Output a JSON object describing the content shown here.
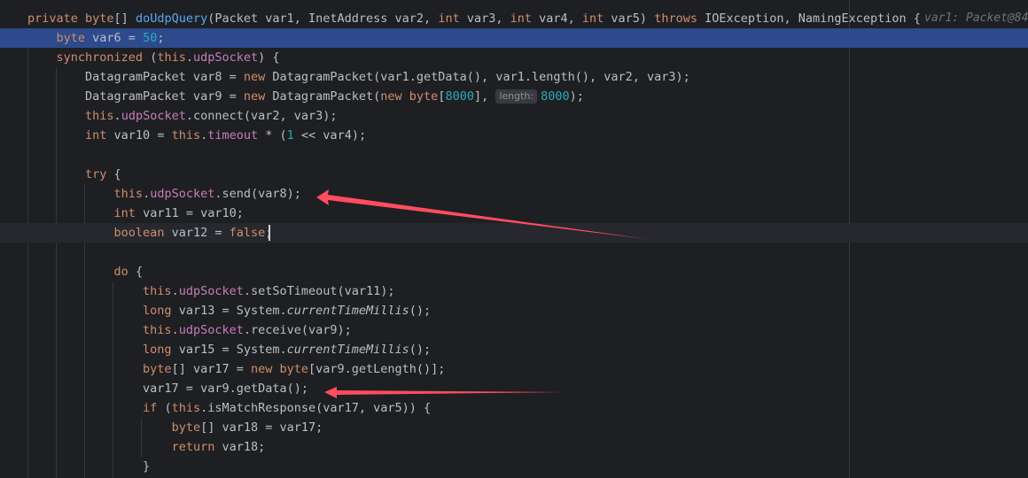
{
  "editor": {
    "colors": {
      "background": "#1e1f22",
      "execution_line": "#2d4a8c",
      "keyword": "#cf8e6d",
      "method": "#56a8f5",
      "field": "#c77dbb",
      "number": "#2aacb8",
      "text": "#bcbec4",
      "arrow": "#ff4d5e"
    },
    "debug_hint": "var1: Packet@84",
    "inlay_hint_label": "length:",
    "lines": [
      [
        [
          "kw",
          "private "
        ],
        [
          "kw",
          "byte"
        ],
        [
          "t",
          "[] "
        ],
        [
          "fn",
          "doUdpQuery"
        ],
        [
          "t",
          "(Packet var1, InetAddress var2, "
        ],
        [
          "kw",
          "int "
        ],
        [
          "t",
          "var3, "
        ],
        [
          "kw",
          "int "
        ],
        [
          "t",
          "var4, "
        ],
        [
          "kw",
          "int "
        ],
        [
          "t",
          "var5) "
        ],
        [
          "kw",
          "throws "
        ],
        [
          "t",
          "IOException, NamingException {"
        ]
      ],
      [
        [
          "t",
          "    "
        ],
        [
          "kw",
          "byte "
        ],
        [
          "t",
          "var6 = "
        ],
        [
          "num",
          "50"
        ],
        [
          "t",
          ";"
        ]
      ],
      [
        [
          "t",
          "    "
        ],
        [
          "kw",
          "synchronized "
        ],
        [
          "t",
          "("
        ],
        [
          "kw",
          "this"
        ],
        [
          "t",
          "."
        ],
        [
          "field",
          "udpSocket"
        ],
        [
          "t",
          ") {"
        ]
      ],
      [
        [
          "t",
          "        DatagramPacket var8 = "
        ],
        [
          "kw",
          "new "
        ],
        [
          "t",
          "DatagramPacket(var1.getData(), var1.length(), var2, var3);"
        ]
      ],
      [
        [
          "t",
          "        DatagramPacket var9 = "
        ],
        [
          "kw",
          "new "
        ],
        [
          "t",
          "DatagramPacket("
        ],
        [
          "kw",
          "new "
        ],
        [
          "kw",
          "byte"
        ],
        [
          "t",
          "["
        ],
        [
          "num",
          "8000"
        ],
        [
          "t",
          "], "
        ],
        [
          "inlay",
          "length:"
        ],
        [
          "num",
          "8000"
        ],
        [
          "t",
          ");"
        ]
      ],
      [
        [
          "t",
          "        "
        ],
        [
          "kw",
          "this"
        ],
        [
          "t",
          "."
        ],
        [
          "field",
          "udpSocket"
        ],
        [
          "t",
          ".connect(var2, var3);"
        ]
      ],
      [
        [
          "t",
          "        "
        ],
        [
          "kw",
          "int "
        ],
        [
          "t",
          "var10 = "
        ],
        [
          "kw",
          "this"
        ],
        [
          "t",
          "."
        ],
        [
          "field",
          "timeout"
        ],
        [
          "t",
          " * ("
        ],
        [
          "num",
          "1"
        ],
        [
          "t",
          " << var4);"
        ]
      ],
      [
        [
          "t",
          ""
        ]
      ],
      [
        [
          "t",
          "        "
        ],
        [
          "kw",
          "try "
        ],
        [
          "t",
          "{"
        ]
      ],
      [
        [
          "t",
          "            "
        ],
        [
          "kw",
          "this"
        ],
        [
          "t",
          "."
        ],
        [
          "field",
          "udpSocket"
        ],
        [
          "t",
          ".send(var8);"
        ]
      ],
      [
        [
          "t",
          "            "
        ],
        [
          "kw",
          "int "
        ],
        [
          "t",
          "var11 = var10;"
        ]
      ],
      [
        [
          "t",
          "            "
        ],
        [
          "kw",
          "boolean "
        ],
        [
          "t",
          "var12 = "
        ],
        [
          "kw",
          "false"
        ],
        [
          "t",
          ";"
        ]
      ],
      [
        [
          "t",
          ""
        ]
      ],
      [
        [
          "t",
          "            "
        ],
        [
          "kw",
          "do "
        ],
        [
          "t",
          "{"
        ]
      ],
      [
        [
          "t",
          "                "
        ],
        [
          "kw",
          "this"
        ],
        [
          "t",
          "."
        ],
        [
          "field",
          "udpSocket"
        ],
        [
          "t",
          ".setSoTimeout(var11);"
        ]
      ],
      [
        [
          "t",
          "                "
        ],
        [
          "kw",
          "long "
        ],
        [
          "t",
          "var13 = System."
        ],
        [
          "st",
          "currentTimeMillis"
        ],
        [
          "t",
          "();"
        ]
      ],
      [
        [
          "t",
          "                "
        ],
        [
          "kw",
          "this"
        ],
        [
          "t",
          "."
        ],
        [
          "field",
          "udpSocket"
        ],
        [
          "t",
          ".receive(var9);"
        ]
      ],
      [
        [
          "t",
          "                "
        ],
        [
          "kw",
          "long "
        ],
        [
          "t",
          "var15 = System."
        ],
        [
          "st",
          "currentTimeMillis"
        ],
        [
          "t",
          "();"
        ]
      ],
      [
        [
          "t",
          "                "
        ],
        [
          "kw",
          "byte"
        ],
        [
          "t",
          "[] var17 = "
        ],
        [
          "kw",
          "new "
        ],
        [
          "kw",
          "byte"
        ],
        [
          "t",
          "[var9.getLength()];"
        ]
      ],
      [
        [
          "t",
          "                var17 = var9.getData();"
        ]
      ],
      [
        [
          "t",
          "                "
        ],
        [
          "kw",
          "if "
        ],
        [
          "t",
          "("
        ],
        [
          "kw",
          "this"
        ],
        [
          "t",
          ".isMatchResponse(var17, var5)) {"
        ]
      ],
      [
        [
          "t",
          "                    "
        ],
        [
          "kw",
          "byte"
        ],
        [
          "t",
          "[] var18 = var17;"
        ]
      ],
      [
        [
          "t",
          "                    "
        ],
        [
          "kw",
          "return "
        ],
        [
          "t",
          "var18;"
        ]
      ],
      [
        [
          "t",
          "                }"
        ]
      ]
    ]
  }
}
